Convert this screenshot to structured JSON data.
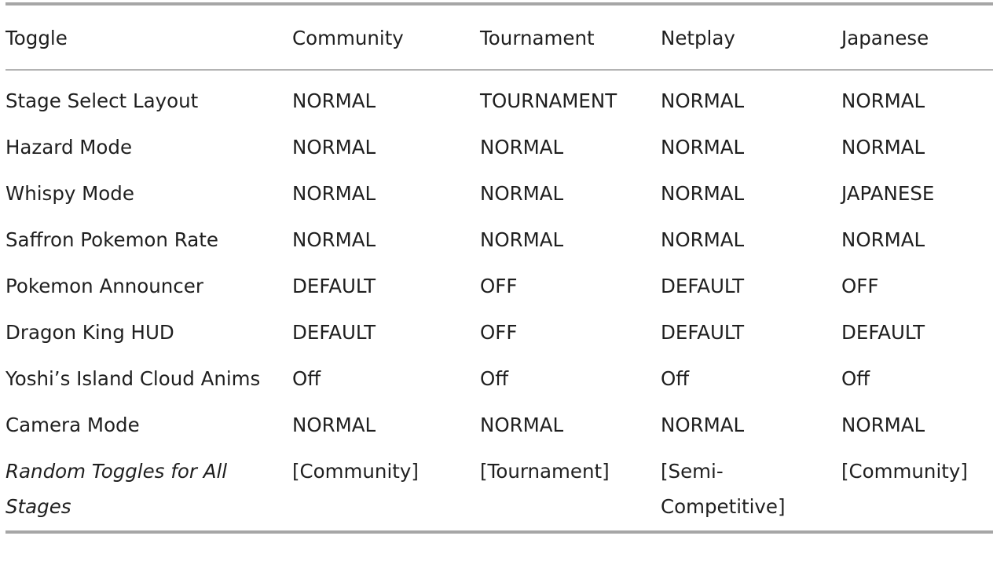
{
  "table": {
    "headers": [
      "Toggle",
      "Community",
      "Tournament",
      "Netplay",
      "Japanese"
    ],
    "rows": [
      {
        "label": "Stage Select Layout",
        "italic": false,
        "values": [
          "NORMAL",
          "TOURNAMENT",
          "NORMAL",
          "NORMAL"
        ]
      },
      {
        "label": "Hazard Mode",
        "italic": false,
        "values": [
          "NORMAL",
          "NORMAL",
          "NORMAL",
          "NORMAL"
        ]
      },
      {
        "label": "Whispy Mode",
        "italic": false,
        "values": [
          "NORMAL",
          "NORMAL",
          "NORMAL",
          "JAPANESE"
        ]
      },
      {
        "label": "Saffron Pokemon Rate",
        "italic": false,
        "values": [
          "NORMAL",
          "NORMAL",
          "NORMAL",
          "NORMAL"
        ]
      },
      {
        "label": "Pokemon Announcer",
        "italic": false,
        "values": [
          "DEFAULT",
          "OFF",
          "DEFAULT",
          "OFF"
        ]
      },
      {
        "label": "Dragon King HUD",
        "italic": false,
        "values": [
          "DEFAULT",
          "OFF",
          "DEFAULT",
          "DEFAULT"
        ]
      },
      {
        "label": "Yoshi’s Island Cloud Anims",
        "italic": false,
        "values": [
          "Off",
          "Off",
          "Off",
          "Off"
        ]
      },
      {
        "label": "Camera Mode",
        "italic": false,
        "values": [
          "NORMAL",
          "NORMAL",
          "NORMAL",
          "NORMAL"
        ]
      },
      {
        "label": "Random Toggles for All Stages",
        "italic": true,
        "values": [
          "[Community]",
          "[Tournament]",
          "[Semi-Competitive]",
          "[Community]"
        ]
      }
    ]
  }
}
